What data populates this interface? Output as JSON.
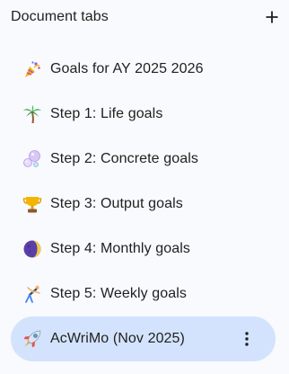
{
  "header": {
    "title": "Document tabs",
    "add_icon": "plus-icon"
  },
  "tabs": [
    {
      "label": "Goals for AY 2025 2026",
      "icon": "party-popper-icon",
      "active": false
    },
    {
      "label": "Step 1: Life goals",
      "icon": "palm-tree-icon",
      "active": false
    },
    {
      "label": "Step 2: Concrete goals",
      "icon": "bubbles-icon",
      "active": false
    },
    {
      "label": "Step 3: Output goals",
      "icon": "trophy-icon",
      "active": false
    },
    {
      "label": "Step 4: Monthly goals",
      "icon": "moon-icon",
      "active": false
    },
    {
      "label": "Step 5: Weekly goals",
      "icon": "cartwheel-person-icon",
      "active": false
    },
    {
      "label": "AcWriMo (Nov 2025)",
      "icon": "rocket-icon",
      "active": true,
      "more_icon": "more-vert-icon"
    }
  ],
  "colors": {
    "panel_background": "#f8fafd",
    "active_tab_background": "#d3e3fd",
    "text": "#1f1f1f"
  }
}
